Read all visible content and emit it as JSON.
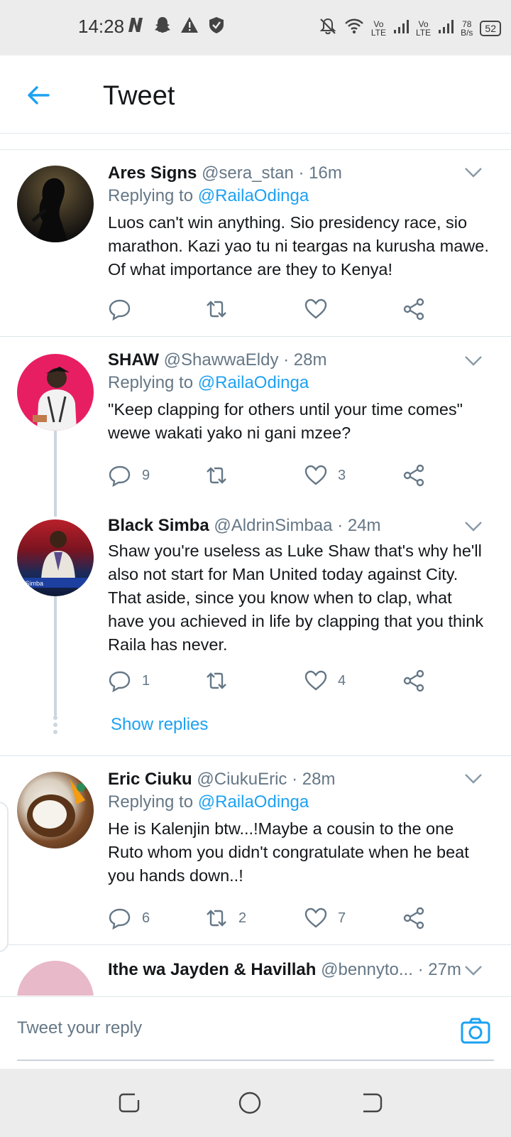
{
  "status_bar": {
    "time": "14:28",
    "net_speed_top": "78",
    "net_speed_bottom": "B/s",
    "battery": "52",
    "lte1_top": "Vo",
    "lte1_bottom": "LTE",
    "lte2_top": "Vo",
    "lte2_bottom": "LTE"
  },
  "header": {
    "title": "Tweet"
  },
  "tweets": [
    {
      "name": "Ares Signs",
      "handle": "@sera_stan",
      "time": "· 16m",
      "replying_prefix": "Replying to",
      "replying_to": "@RailaOdinga",
      "text": "Luos can't win anything. Sio presidency race, sio marathon. Kazi yao tu ni teargas na kurusha mawe. Of what importance are they to Kenya!",
      "replies": "",
      "retweets": "",
      "likes": ""
    },
    {
      "name": "SHAW",
      "handle": "@ShawwaEldy",
      "time": "· 28m",
      "replying_prefix": "Replying to",
      "replying_to": "@RailaOdinga",
      "text": "\"Keep clapping for others until your time comes\" wewe wakati yako ni gani mzee?",
      "replies": "9",
      "retweets": "",
      "likes": "3"
    },
    {
      "name": "Black Simba",
      "handle": "@AldrinSimbaa",
      "time": "· 24m",
      "text": "Shaw you're useless as Luke Shaw that's why he'll also not start for Man United today against City. That aside, since you know when to clap, what have you achieved in life by clapping that you think Raila has never.",
      "replies": "1",
      "retweets": "",
      "likes": "4",
      "avatar_caption": "a Simba"
    },
    {
      "name": "Eric Ciuku",
      "handle": "@CiukuEric",
      "time": "· 28m",
      "replying_prefix": "Replying to",
      "replying_to": "@RailaOdinga",
      "text": "He is Kalenjin btw...!Maybe a cousin to the one Ruto whom you didn't congratulate when he beat you hands down..!",
      "replies": "6",
      "retweets": "2",
      "likes": "7"
    },
    {
      "name": "Ithe wa Jayden & Havillah",
      "handle": "@bennyto...",
      "time": "· 27m"
    }
  ],
  "show_replies": "Show replies",
  "reply_bar": {
    "placeholder": "Tweet your reply"
  },
  "colors": {
    "accent": "#1da1f2",
    "muted": "#657786",
    "text": "#14171a"
  }
}
